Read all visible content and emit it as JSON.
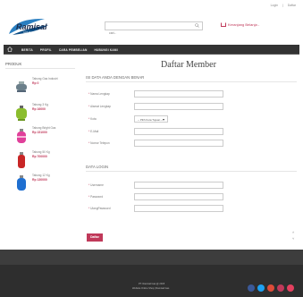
{
  "toplinks": [
    "Login",
    "|",
    "Daftar"
  ],
  "brand": {
    "name": "Ramisal",
    "tagline": "GAS Elpiji"
  },
  "search": {
    "placeholder": "cari..."
  },
  "cart": {
    "label": "Keranjang Belanja -"
  },
  "nav": {
    "items": [
      "BERITA",
      "PROFIL",
      "CARA PEMBELIAN",
      "HUBUNGI KAMI"
    ]
  },
  "sidebar": {
    "title": "PRODUK",
    "products": [
      {
        "name": "Tabung Gas Industri",
        "price": "Rp 0"
      },
      {
        "name": "Tabung 3 Kg",
        "price": "Rp 16000"
      },
      {
        "name": "Tabung Bright Gas",
        "price": "Rp 151000"
      },
      {
        "name": "Tabung 50 Kg",
        "price": "Rp 700000"
      },
      {
        "name": "Tabung 12 Kg",
        "price": "Rp 130000"
      }
    ]
  },
  "page": {
    "title": "Daftar Member",
    "section1": "ISI DATA ANDA DENGAN BENAR",
    "section2": "DATA LOGIN"
  },
  "form": {
    "nama": "Nama Lengkap",
    "alamat": "Alamat Lengkap",
    "kota": "Kota",
    "kota_select": "-- Pilih Kota Tujuan --",
    "email": "E-Mail",
    "telepon": "Nomor Telepon",
    "username": "Username",
    "password": "Password",
    "ulang": "UlangPassword",
    "required_mark": "*",
    "submit": "Daftar"
  },
  "scroll": {
    "up": "˄",
    "down": "˅"
  },
  "footer": {
    "address": "Jl. Potlot Raya, Kecamatan Semarang",
    "phone": "(024) - 7288803",
    "email": "ramisal@yahoo.com",
    "copy1": "PT. Ramisal Gas @ 2015",
    "copy2": "Website Online Shop | Ramisal Gas"
  },
  "colors": {
    "accent": "#c0395a",
    "social": [
      "#3b5998",
      "#1da1f2",
      "#dd4b39",
      "#c0395a",
      "#e4405f"
    ]
  }
}
